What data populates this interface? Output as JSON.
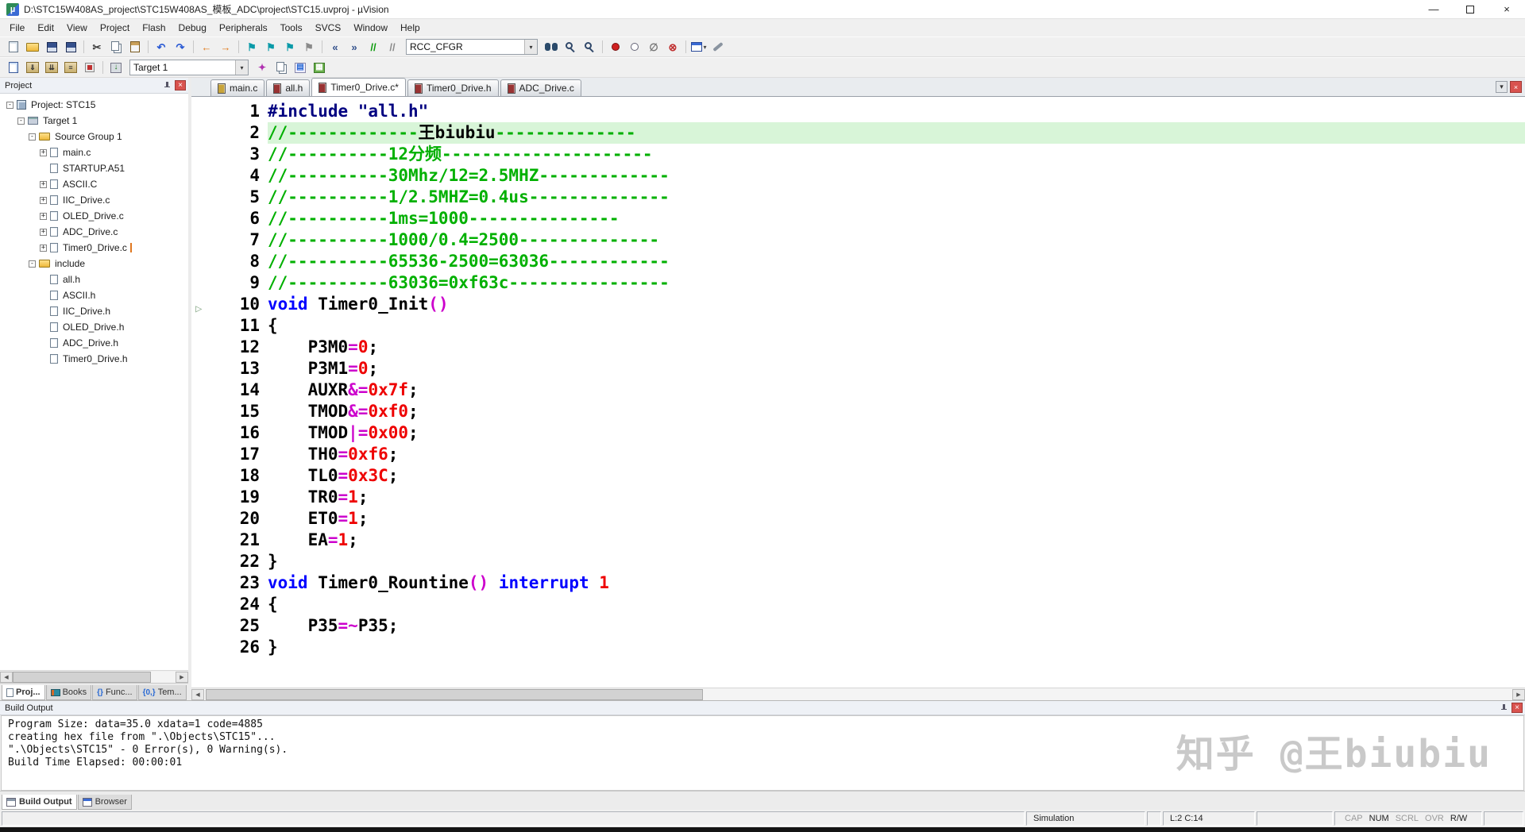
{
  "window": {
    "title": "D:\\STC15W408AS_project\\STC15W408AS_模板_ADC\\project\\STC15.uvproj - µVision",
    "app_glyph": "µ",
    "minimize": "—",
    "close": "×"
  },
  "menu": {
    "items": [
      "File",
      "Edit",
      "View",
      "Project",
      "Flash",
      "Debug",
      "Peripherals",
      "Tools",
      "SVCS",
      "Window",
      "Help"
    ]
  },
  "toolbar1": {
    "combo_value": "RCC_CFGR",
    "icons_left": [
      {
        "name": "new-file-icon",
        "cls": "pg"
      },
      {
        "name": "open-file-icon",
        "cls": "fld"
      },
      {
        "name": "save-icon",
        "cls": "sv"
      },
      {
        "name": "save-all-icon",
        "cls": "sv"
      },
      {
        "sep": true
      },
      {
        "name": "cut-icon",
        "cls": "tx",
        "glyph": "✂",
        "color": "#3a3a3a"
      },
      {
        "name": "copy-icon",
        "cls": "cp"
      },
      {
        "name": "paste-icon",
        "cls": "pst"
      },
      {
        "sep": true
      },
      {
        "name": "undo-icon",
        "cls": "tx",
        "glyph": "↶",
        "color": "#2a5ad4"
      },
      {
        "name": "redo-icon",
        "cls": "tx",
        "glyph": "↷",
        "color": "#2a5ad4"
      },
      {
        "sep": true
      },
      {
        "name": "navigate-back-icon",
        "cls": "tx",
        "glyph": "←",
        "color": "#e07818"
      },
      {
        "name": "navigate-forward-icon",
        "cls": "tx",
        "glyph": "→",
        "color": "#e07818"
      },
      {
        "sep": true
      },
      {
        "name": "bookmark-toggle-icon",
        "cls": "tx",
        "glyph": "⚑",
        "color": "#0a9aa8"
      },
      {
        "name": "bookmark-previous-icon",
        "cls": "tx",
        "glyph": "⚑",
        "color": "#0a9aa8"
      },
      {
        "name": "bookmark-next-icon",
        "cls": "tx",
        "glyph": "⚑",
        "color": "#0a9aa8"
      },
      {
        "name": "bookmark-clear-all-icon",
        "cls": "tx",
        "glyph": "⚑",
        "color": "#8a8a8a"
      },
      {
        "sep": true
      },
      {
        "name": "unindent-icon",
        "cls": "tx",
        "glyph": "«",
        "color": "#33518c"
      },
      {
        "name": "indent-icon",
        "cls": "tx",
        "glyph": "»",
        "color": "#33518c"
      },
      {
        "name": "comment-icon",
        "cls": "tx",
        "glyph": "//",
        "color": "#0a9a0a"
      },
      {
        "name": "uncomment-icon",
        "cls": "tx",
        "glyph": "//",
        "color": "#8a8a8a"
      }
    ],
    "icons_right": [
      {
        "name": "find-in-files-icon",
        "cls": "bino"
      },
      {
        "name": "find-icon",
        "cls": "mag"
      },
      {
        "name": "incremental-find-icon",
        "cls": "mag"
      },
      {
        "sep": true
      },
      {
        "name": "insert-breakpoint-icon",
        "cls": "bpr"
      },
      {
        "name": "enable-breakpoint-icon",
        "cls": "bph"
      },
      {
        "name": "disable-all-breakpoints-icon",
        "cls": "tx",
        "glyph": "∅",
        "color": "#777777"
      },
      {
        "name": "kill-all-breakpoints-icon",
        "cls": "tx",
        "glyph": "⊗",
        "color": "#c03030"
      },
      {
        "sep": true
      },
      {
        "name": "window-layout-icon",
        "cls": "winb",
        "dd": true
      },
      {
        "name": "configure-icon",
        "cls": "wr"
      }
    ]
  },
  "toolbar2": {
    "combo_value": "Target 1",
    "icons_left": [
      {
        "name": "translate-file-icon",
        "cls": "pg2"
      },
      {
        "name": "build-icon",
        "cls": "bld",
        "glyph": "⇓"
      },
      {
        "name": "rebuild-all-icon",
        "cls": "bld",
        "glyph": "⇊"
      },
      {
        "name": "batch-build-icon",
        "cls": "bld",
        "glyph": "≡"
      },
      {
        "name": "stop-build-icon",
        "cls": "stp"
      },
      {
        "sep": true
      },
      {
        "name": "download-to-flash-icon",
        "cls": "dl",
        "glyph": "↓"
      }
    ],
    "icons_right": [
      {
        "name": "options-for-target-icon",
        "cls": "wand",
        "glyph": "✦",
        "color": "#b030b0"
      },
      {
        "name": "file-extensions-icon",
        "cls": "cp"
      },
      {
        "name": "software-packs-icon",
        "cls": "gen2",
        "glyph": "▤",
        "color": "#2a6ad4"
      },
      {
        "name": "manage-run-time-environment-icon",
        "cls": "grn",
        "glyph": "▦"
      }
    ]
  },
  "project_panel": {
    "title": "Project",
    "tree": [
      {
        "label": "Project: STC15",
        "level": 0,
        "exp": "-",
        "ic": "chip"
      },
      {
        "label": "Target 1",
        "level": 1,
        "exp": "-",
        "ic": "target"
      },
      {
        "label": "Source Group 1",
        "level": 2,
        "exp": "-",
        "ic": "folder"
      },
      {
        "label": "main.c",
        "level": 3,
        "exp": "+",
        "ic": "page"
      },
      {
        "label": "STARTUP.A51",
        "level": 3,
        "ic": "page"
      },
      {
        "label": "ASCII.C",
        "level": 3,
        "exp": "+",
        "ic": "page"
      },
      {
        "label": "IIC_Drive.c",
        "level": 3,
        "exp": "+",
        "ic": "page"
      },
      {
        "label": "OLED_Drive.c",
        "level": 3,
        "exp": "+",
        "ic": "page"
      },
      {
        "label": "ADC_Drive.c",
        "level": 3,
        "exp": "+",
        "ic": "page"
      },
      {
        "label": "Timer0_Drive.c",
        "level": 3,
        "exp": "+",
        "ic": "page",
        "sel": true
      },
      {
        "label": "include",
        "level": 2,
        "exp": "-",
        "ic": "folder"
      },
      {
        "label": "all.h",
        "level": 3,
        "ic": "page"
      },
      {
        "label": "ASCII.h",
        "level": 3,
        "ic": "page"
      },
      {
        "label": "IIC_Drive.h",
        "level": 3,
        "ic": "page"
      },
      {
        "label": "OLED_Drive.h",
        "level": 3,
        "ic": "page"
      },
      {
        "label": "ADC_Drive.h",
        "level": 3,
        "ic": "page"
      },
      {
        "label": "Timer0_Drive.h",
        "level": 3,
        "ic": "page"
      }
    ],
    "bottom_tabs": [
      {
        "label": "Proj...",
        "ic": "page",
        "active": true
      },
      {
        "label": "Books",
        "ic": "book"
      },
      {
        "label": "Func...",
        "glyph": "{}"
      },
      {
        "label": "Tem...",
        "glyph": "{0,}"
      }
    ]
  },
  "editor": {
    "tabs": [
      {
        "label": "main.c",
        "icon_color": "#c8a43a"
      },
      {
        "label": "all.h",
        "icon_color": "#993333"
      },
      {
        "label": "Timer0_Drive.c*",
        "icon_color": "#993333",
        "active": true
      },
      {
        "label": "Timer0_Drive.h",
        "icon_color": "#993333"
      },
      {
        "label": "ADC_Drive.c",
        "icon_color": "#993333"
      }
    ],
    "tab_dropdown_glyph": "▾",
    "tab_close_glyph": "×",
    "lines": [
      {
        "num": 1,
        "s": [
          {
            "c": "pp",
            "t": "#include \"all.h\""
          }
        ]
      },
      {
        "num": 2,
        "hl": true,
        "s": [
          {
            "c": "cm",
            "t": "//-------------"
          },
          {
            "c": "id",
            "t": "王biubiu"
          },
          {
            "c": "cm",
            "t": "--------------"
          }
        ]
      },
      {
        "num": 3,
        "s": [
          {
            "c": "cm",
            "t": "//----------12分频---------------------"
          }
        ]
      },
      {
        "num": 4,
        "s": [
          {
            "c": "cm",
            "t": "//----------30Mhz/12=2.5MHZ-------------"
          }
        ]
      },
      {
        "num": 5,
        "s": [
          {
            "c": "cm",
            "t": "//----------1/2.5MHZ=0.4us--------------"
          }
        ]
      },
      {
        "num": 6,
        "s": [
          {
            "c": "cm",
            "t": "//----------1ms=1000---------------"
          }
        ]
      },
      {
        "num": 7,
        "s": [
          {
            "c": "cm",
            "t": "//----------1000/0.4=2500--------------"
          }
        ]
      },
      {
        "num": 8,
        "s": [
          {
            "c": "cm",
            "t": "//----------65536-2500=63036------------"
          }
        ]
      },
      {
        "num": 9,
        "s": [
          {
            "c": "cm",
            "t": "//----------63036=0xf63c----------------"
          }
        ]
      },
      {
        "num": 10,
        "s": [
          {
            "c": "kw",
            "t": "void"
          },
          {
            "c": "id",
            "t": " Timer0_Init"
          },
          {
            "c": "op",
            "t": "()"
          }
        ]
      },
      {
        "num": 11,
        "s": [
          {
            "c": "id",
            "t": "{"
          }
        ]
      },
      {
        "num": 12,
        "s": [
          {
            "c": "id",
            "t": "    P3M0"
          },
          {
            "c": "op",
            "t": "="
          },
          {
            "c": "num",
            "t": "0"
          },
          {
            "c": "id",
            "t": ";"
          }
        ]
      },
      {
        "num": 13,
        "s": [
          {
            "c": "id",
            "t": "    P3M1"
          },
          {
            "c": "op",
            "t": "="
          },
          {
            "c": "num",
            "t": "0"
          },
          {
            "c": "id",
            "t": ";"
          }
        ]
      },
      {
        "num": 14,
        "s": [
          {
            "c": "id",
            "t": "    AUXR"
          },
          {
            "c": "op",
            "t": "&="
          },
          {
            "c": "num",
            "t": "0x7f"
          },
          {
            "c": "id",
            "t": ";"
          }
        ]
      },
      {
        "num": 15,
        "s": [
          {
            "c": "id",
            "t": "    TMOD"
          },
          {
            "c": "op",
            "t": "&="
          },
          {
            "c": "num",
            "t": "0xf0"
          },
          {
            "c": "id",
            "t": ";"
          }
        ]
      },
      {
        "num": 16,
        "s": [
          {
            "c": "id",
            "t": "    TMOD"
          },
          {
            "c": "op",
            "t": "|="
          },
          {
            "c": "num",
            "t": "0x00"
          },
          {
            "c": "id",
            "t": ";"
          }
        ]
      },
      {
        "num": 17,
        "s": [
          {
            "c": "id",
            "t": "    TH0"
          },
          {
            "c": "op",
            "t": "="
          },
          {
            "c": "num",
            "t": "0xf6"
          },
          {
            "c": "id",
            "t": ";"
          }
        ]
      },
      {
        "num": 18,
        "s": [
          {
            "c": "id",
            "t": "    TL0"
          },
          {
            "c": "op",
            "t": "="
          },
          {
            "c": "num",
            "t": "0x3C"
          },
          {
            "c": "id",
            "t": ";"
          }
        ]
      },
      {
        "num": 19,
        "s": [
          {
            "c": "id",
            "t": "    TR0"
          },
          {
            "c": "op",
            "t": "="
          },
          {
            "c": "num",
            "t": "1"
          },
          {
            "c": "id",
            "t": ";"
          }
        ]
      },
      {
        "num": 20,
        "s": [
          {
            "c": "id",
            "t": "    ET0"
          },
          {
            "c": "op",
            "t": "="
          },
          {
            "c": "num",
            "t": "1"
          },
          {
            "c": "id",
            "t": ";"
          }
        ]
      },
      {
        "num": 21,
        "s": [
          {
            "c": "id",
            "t": "    EA"
          },
          {
            "c": "op",
            "t": "="
          },
          {
            "c": "num",
            "t": "1"
          },
          {
            "c": "id",
            "t": ";"
          }
        ]
      },
      {
        "num": 22,
        "s": [
          {
            "c": "id",
            "t": "}"
          }
        ]
      },
      {
        "num": 23,
        "s": [
          {
            "c": "kw",
            "t": "void"
          },
          {
            "c": "id",
            "t": " Timer0_Rountine"
          },
          {
            "c": "op",
            "t": "()"
          },
          {
            "c": "kw",
            "t": " interrupt"
          },
          {
            "c": "num",
            "t": " 1"
          }
        ]
      },
      {
        "num": 24,
        "s": [
          {
            "c": "id",
            "t": "{"
          }
        ]
      },
      {
        "num": 25,
        "s": [
          {
            "c": "id",
            "t": "    P35"
          },
          {
            "c": "op",
            "t": "=~"
          },
          {
            "c": "id",
            "t": "P35;"
          }
        ]
      },
      {
        "num": 26,
        "s": [
          {
            "c": "id",
            "t": "}"
          }
        ]
      }
    ]
  },
  "build_output": {
    "title": "Build Output",
    "lines": [
      "Program Size: data=35.0 xdata=1 code=4885",
      "creating hex file from \".\\Objects\\STC15\"...",
      "\".\\Objects\\STC15\" - 0 Error(s), 0 Warning(s).",
      "Build Time Elapsed:  00:00:01"
    ],
    "tabs": [
      {
        "label": "Build Output",
        "ic": "win-gray",
        "active": true
      },
      {
        "label": "Browser",
        "ic": "win-blue"
      }
    ],
    "watermark": "知乎 @王biubiu"
  },
  "status_bar": {
    "mode": "Simulation",
    "cursor": "L:2 C:14",
    "flags": [
      {
        "label": "CAP",
        "active": false
      },
      {
        "label": "NUM",
        "active": true
      },
      {
        "label": "SCRL",
        "active": false
      },
      {
        "label": "OVR",
        "active": false
      },
      {
        "label": "R/W",
        "active": true
      }
    ]
  }
}
